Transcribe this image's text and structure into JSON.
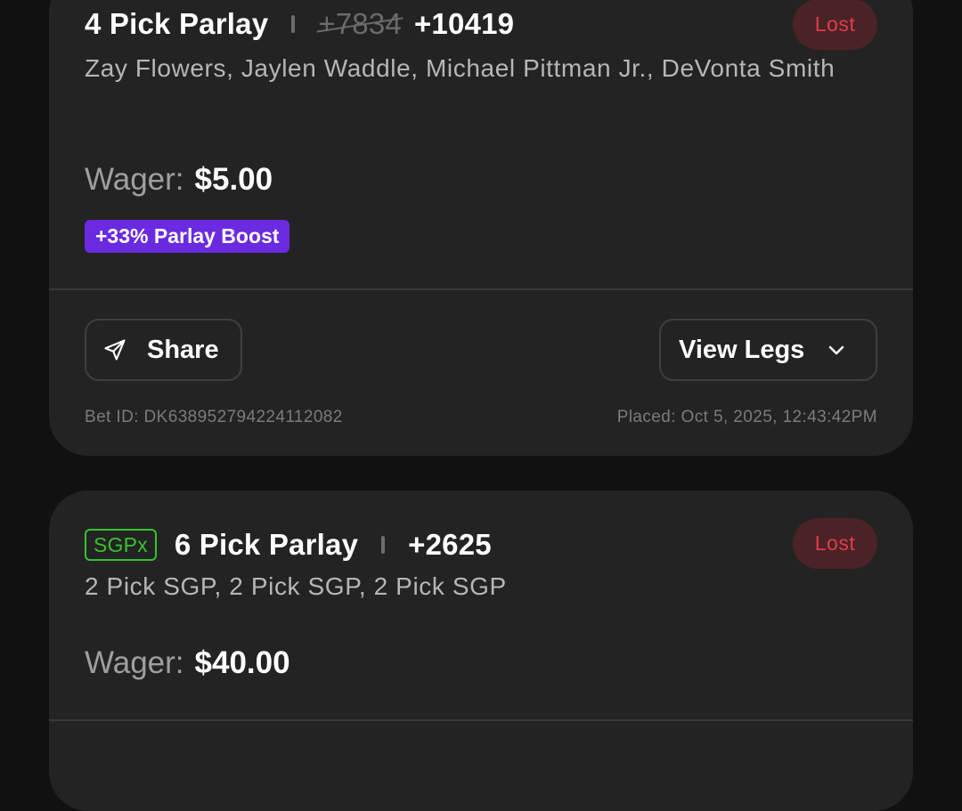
{
  "bets": [
    {
      "title": "4 Pick Parlay",
      "original_odds": "+7834",
      "odds": "+10419",
      "status": "Lost",
      "legs": "Zay Flowers, Jaylen Waddle, Michael Pittman Jr., DeVonta Smith",
      "wager_label": "Wager:",
      "wager_amount": "$5.00",
      "boost_label": "+33% Parlay Boost",
      "share_label": "Share",
      "view_legs_label": "View Legs",
      "bet_id": "Bet ID: DK638952794224112082",
      "placed": "Placed: Oct 5, 2025, 12:43:42PM"
    },
    {
      "badge": "SGPx",
      "title": "6 Pick Parlay",
      "odds": "+2625",
      "status": "Lost",
      "legs": "2 Pick SGP, 2 Pick SGP, 2 Pick SGP",
      "wager_label": "Wager:",
      "wager_amount": "$40.00"
    }
  ],
  "colors": {
    "background": "#111111",
    "card": "#232323",
    "lost_bg": "#4a2326",
    "lost_text": "#e23b4a",
    "boost": "#6a2ae0",
    "sgpx": "#37c22e"
  },
  "icons": {
    "share": "paper-plane-icon",
    "view_legs": "chevron-down-icon"
  }
}
